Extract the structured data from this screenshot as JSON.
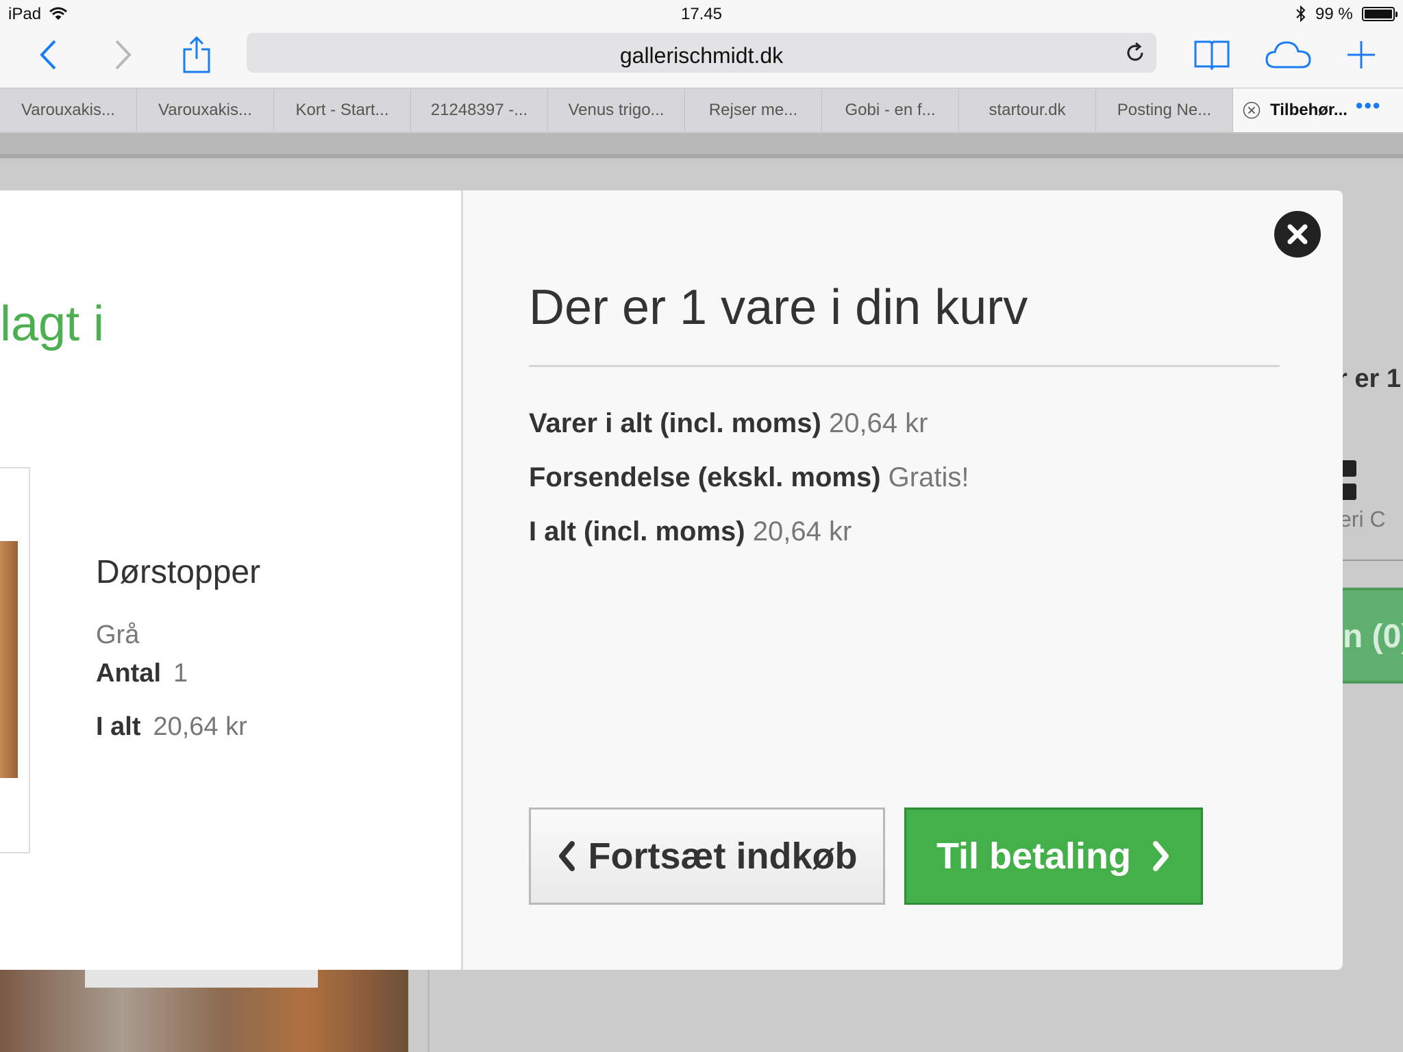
{
  "status_bar": {
    "device": "iPad",
    "time": "17.45",
    "battery": "99 %"
  },
  "toolbar": {
    "url": "gallerischmidt.dk"
  },
  "tabs": [
    {
      "label": "Varouxakis..."
    },
    {
      "label": "Varouxakis..."
    },
    {
      "label": "Kort - Start..."
    },
    {
      "label": "21248397 -..."
    },
    {
      "label": "Venus trigo..."
    },
    {
      "label": "Rejser me..."
    },
    {
      "label": "Gobi - en f..."
    },
    {
      "label": "startour.dk"
    },
    {
      "label": "Posting Ne..."
    },
    {
      "label": "Tilbehør...",
      "active": true
    }
  ],
  "background": {
    "right_text": "r er 1",
    "right_small": "eri   C",
    "right_button": "n (0)"
  },
  "added_panel": {
    "heading": "lagt i",
    "product_name": "Dørstopper",
    "variant": "Grå",
    "quantity_label": "Antal",
    "quantity_value": "1",
    "total_label": "I alt",
    "total_value": "20,64 kr"
  },
  "cart_panel": {
    "title": "Der er 1 vare i din kurv",
    "rows": [
      {
        "label": "Varer i alt (incl. moms)",
        "value": "20,64 kr"
      },
      {
        "label": "Forsendelse (ekskl. moms)",
        "value": "Gratis!"
      },
      {
        "label": "I alt (incl. moms)",
        "value": "20,64 kr"
      }
    ],
    "continue_label": "Fortsæt indkøb",
    "checkout_label": "Til betaling"
  },
  "colors": {
    "accent_blue": "#1a7cf5",
    "added_green": "#4caf50",
    "checkout_green": "#43b049"
  }
}
